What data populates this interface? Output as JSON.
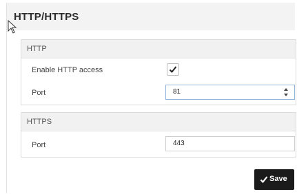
{
  "header": {
    "title": "HTTP/HTTPS"
  },
  "http": {
    "title": "HTTP",
    "enable_label": "Enable HTTP access",
    "enable_checked": true,
    "port_label": "Port",
    "port_value": "81"
  },
  "https": {
    "title": "HTTPS",
    "port_label": "Port",
    "port_value": "443"
  },
  "actions": {
    "save_label": "Save"
  },
  "icons": {
    "cursor": "mouse-pointer-icon",
    "checkmark": "checkmark-icon",
    "spinner": "spinner-arrows-icon",
    "save": "checkmark-icon"
  },
  "colors": {
    "save_button_bg": "#1b1b1b",
    "focus_border": "#8fb3d9"
  }
}
